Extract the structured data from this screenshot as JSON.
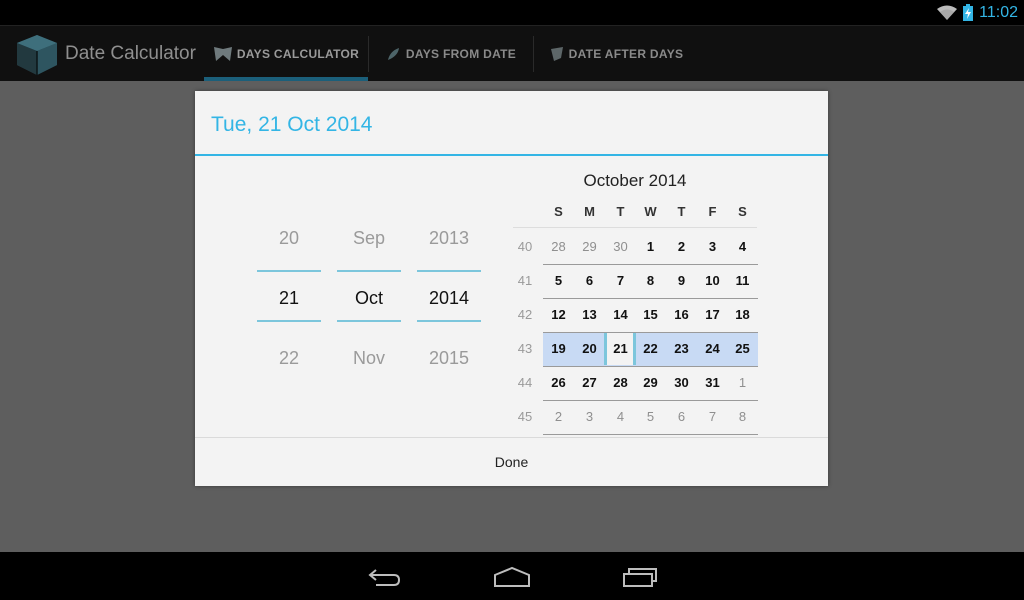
{
  "status_bar": {
    "time": "11:02",
    "icons": [
      "wifi-icon",
      "battery-charging-icon"
    ],
    "clock_color": "#33b5e5"
  },
  "action_bar": {
    "app_title": "Date Calculator",
    "tabs": [
      {
        "label": "DAYS CALCULATOR",
        "icon": "calendar-fold-icon",
        "active": true
      },
      {
        "label": "DAYS FROM DATE",
        "icon": "feather-icon",
        "active": false
      },
      {
        "label": "DATE AFTER DAYS",
        "icon": "page-icon",
        "active": false
      }
    ],
    "indicator_color": "#1b5f7a"
  },
  "dialog": {
    "title": "Tue, 21 Oct 2014",
    "accent_color": "#33b5e5",
    "pickers": {
      "day": {
        "prev": "20",
        "selected": "21",
        "next": "22"
      },
      "month": {
        "prev": "Sep",
        "selected": "Oct",
        "next": "Nov"
      },
      "year": {
        "prev": "2013",
        "selected": "2014",
        "next": "2015"
      }
    },
    "calendar": {
      "month_title": "October 2014",
      "weekdays": [
        "S",
        "M",
        "T",
        "W",
        "T",
        "F",
        "S"
      ],
      "selected_day": "21",
      "selected_week": "43",
      "weeks": [
        {
          "num": "40",
          "days": [
            {
              "d": "28",
              "other": true
            },
            {
              "d": "29",
              "other": true
            },
            {
              "d": "30",
              "other": true
            },
            {
              "d": "1"
            },
            {
              "d": "2"
            },
            {
              "d": "3"
            },
            {
              "d": "4"
            }
          ]
        },
        {
          "num": "41",
          "days": [
            {
              "d": "5"
            },
            {
              "d": "6"
            },
            {
              "d": "7"
            },
            {
              "d": "8"
            },
            {
              "d": "9"
            },
            {
              "d": "10"
            },
            {
              "d": "11"
            }
          ]
        },
        {
          "num": "42",
          "days": [
            {
              "d": "12"
            },
            {
              "d": "13"
            },
            {
              "d": "14"
            },
            {
              "d": "15"
            },
            {
              "d": "16"
            },
            {
              "d": "17"
            },
            {
              "d": "18"
            }
          ]
        },
        {
          "num": "43",
          "days": [
            {
              "d": "19"
            },
            {
              "d": "20"
            },
            {
              "d": "21"
            },
            {
              "d": "22"
            },
            {
              "d": "23"
            },
            {
              "d": "24"
            },
            {
              "d": "25"
            }
          ]
        },
        {
          "num": "44",
          "days": [
            {
              "d": "26"
            },
            {
              "d": "27"
            },
            {
              "d": "28"
            },
            {
              "d": "29"
            },
            {
              "d": "30"
            },
            {
              "d": "31"
            },
            {
              "d": "1",
              "other": true
            }
          ]
        },
        {
          "num": "45",
          "days": [
            {
              "d": "2",
              "other": true
            },
            {
              "d": "3",
              "other": true
            },
            {
              "d": "4",
              "other": true
            },
            {
              "d": "5",
              "other": true
            },
            {
              "d": "6",
              "other": true
            },
            {
              "d": "7",
              "other": true
            },
            {
              "d": "8",
              "other": true
            }
          ]
        }
      ]
    },
    "done_label": "Done"
  },
  "nav_bar": {
    "buttons": [
      "back-icon",
      "home-icon",
      "recent-apps-icon"
    ]
  }
}
